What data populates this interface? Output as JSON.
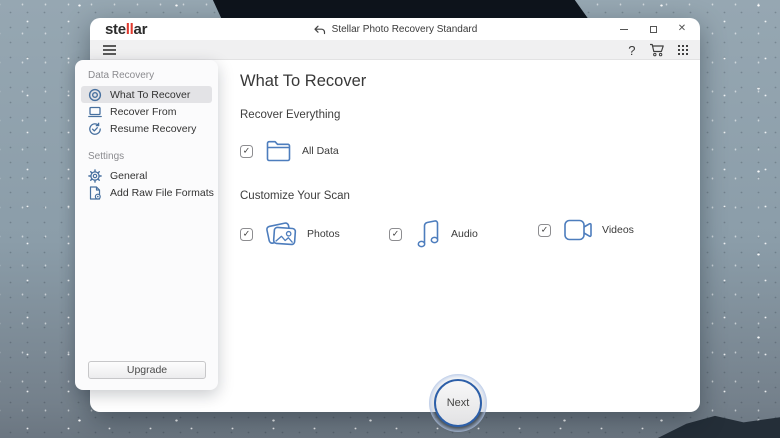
{
  "window": {
    "logo": {
      "pre": "ste",
      "accent": "ll",
      "post": "ar"
    },
    "title": "Stellar Photo Recovery Standard",
    "close_glyph": "✕"
  },
  "toolbar": {
    "help_label": "?"
  },
  "sidebar": {
    "sections": [
      {
        "header": "Data Recovery",
        "items": [
          {
            "label": "What To Recover"
          },
          {
            "label": "Recover From"
          },
          {
            "label": "Resume Recovery"
          }
        ]
      },
      {
        "header": "Settings",
        "items": [
          {
            "label": "General"
          },
          {
            "label": "Add Raw File Formats"
          }
        ]
      }
    ],
    "upgrade_label": "Upgrade"
  },
  "main": {
    "title": "What To Recover",
    "sections": [
      {
        "heading": "Recover Everything",
        "options": [
          {
            "label": "All Data",
            "checked": "✓"
          }
        ]
      },
      {
        "heading": "Customize Your Scan",
        "options": [
          {
            "label": "Photos",
            "checked": "✓"
          },
          {
            "label": "Audio",
            "checked": "✓"
          },
          {
            "label": "Videos",
            "checked": "✓"
          }
        ]
      }
    ],
    "next_label": "Next"
  },
  "colors": {
    "accent_red": "#e03a2e",
    "icon_blue_sidebar": "#47709f",
    "icon_blue_main": "#4d7dbd",
    "next_ring": "#2d5fa8",
    "wallpaper": "#8c9ead"
  }
}
